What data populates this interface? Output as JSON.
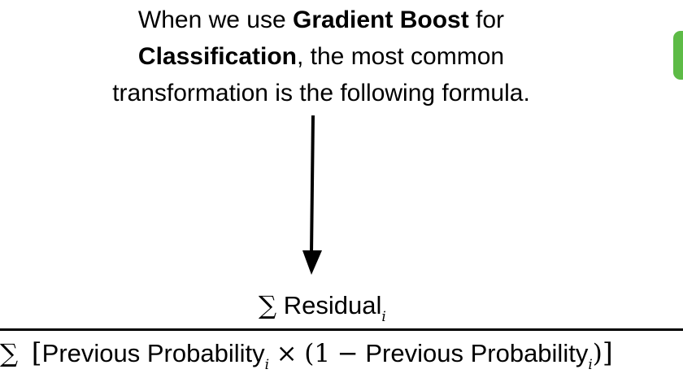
{
  "heading": {
    "text_before": "When we use ",
    "bold_1": "Gradient Boost",
    "text_middle": " for",
    "bold_2": "Classification",
    "text_after_1": ", the most common",
    "text_after_2": "transformation is the following formula."
  },
  "formula": {
    "numerator": {
      "sigma": "∑",
      "label": "Residual",
      "subscript": "i"
    },
    "denominator": {
      "sigma": "∑",
      "open_bracket": "[",
      "term_1": "Previous Probability",
      "subscript_1": "i",
      "times": "×",
      "open_paren": "(",
      "one": "1",
      "minus": "−",
      "term_2": "Previous Probability",
      "subscript_2": "i",
      "close_paren": ")",
      "close_bracket": "]"
    }
  },
  "colors": {
    "accent_tab": "#5dbb46",
    "text": "#000000",
    "background": "#ffffff"
  }
}
